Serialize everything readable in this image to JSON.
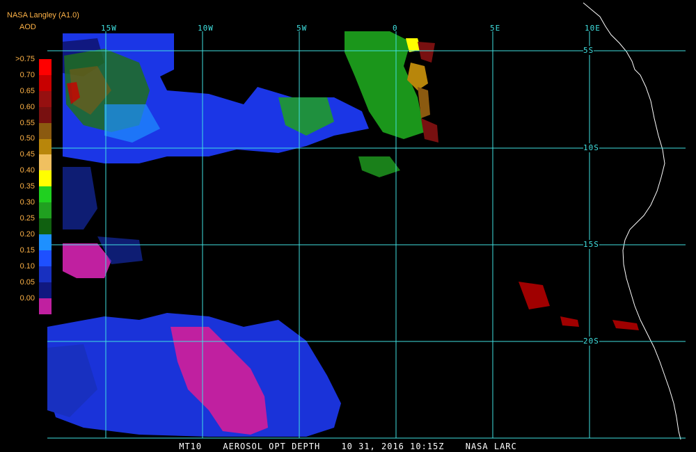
{
  "header": {
    "source": "NASA Langley (A1.0)",
    "variable": "AOD"
  },
  "legend": {
    "labels": [
      ">0.75",
      "0.70",
      "0.65",
      "0.60",
      "0.55",
      "0.50",
      "0.45",
      "0.40",
      "0.35",
      "0.30",
      "0.25",
      "0.20",
      "0.15",
      "0.10",
      "0.05",
      "0.00"
    ],
    "colors": [
      "#ff0000",
      "#c80000",
      "#961010",
      "#781010",
      "#8b5a10",
      "#b8860b",
      "#f0c060",
      "#ffff00",
      "#20d020",
      "#20a020",
      "#106010",
      "#1e90ff",
      "#1e50ff",
      "#1830c0",
      "#101880",
      "#c020a0"
    ]
  },
  "grid": {
    "lon_labels": [
      "15W",
      "10W",
      "5W",
      "0",
      "5E",
      "10E"
    ],
    "lat_labels": [
      "5S",
      "10S",
      "15S",
      "20S"
    ]
  },
  "caption": {
    "product": "MT10",
    "title": "AEROSOL OPT DEPTH",
    "date": "10 31, 2016 10:15Z",
    "agency": "NASA LARC"
  },
  "colors": {
    "grid": "#40e0e0",
    "coast": "#ffffff",
    "background": "#000000"
  }
}
